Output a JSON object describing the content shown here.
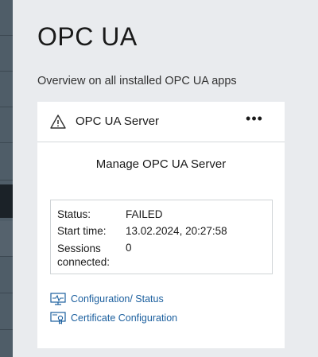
{
  "page": {
    "title": "OPC UA",
    "subtitle": "Overview on all installed OPC UA apps"
  },
  "card": {
    "title": "OPC UA Server",
    "status_icon": "warning-icon",
    "more_icon": "more-icon",
    "more_label": "•••",
    "manage_label": "Manage OPC UA Server",
    "status": {
      "status_label": "Status:",
      "status_value": "FAILED",
      "start_label": "Start time:",
      "start_value": "13.02.2024, 20:27:58",
      "sessions_label_line1": "Sessions",
      "sessions_label_line2": "connected:",
      "sessions_value": "0"
    },
    "links": [
      {
        "label": "Configuration/ Status",
        "icon": "monitor-pulse-icon"
      },
      {
        "label": "Certificate Configuration",
        "icon": "certificate-icon"
      }
    ]
  },
  "colors": {
    "background": "#e9ebee",
    "nav": "#4f5d68",
    "nav_active": "#1b2228",
    "link": "#1b5f9e"
  }
}
